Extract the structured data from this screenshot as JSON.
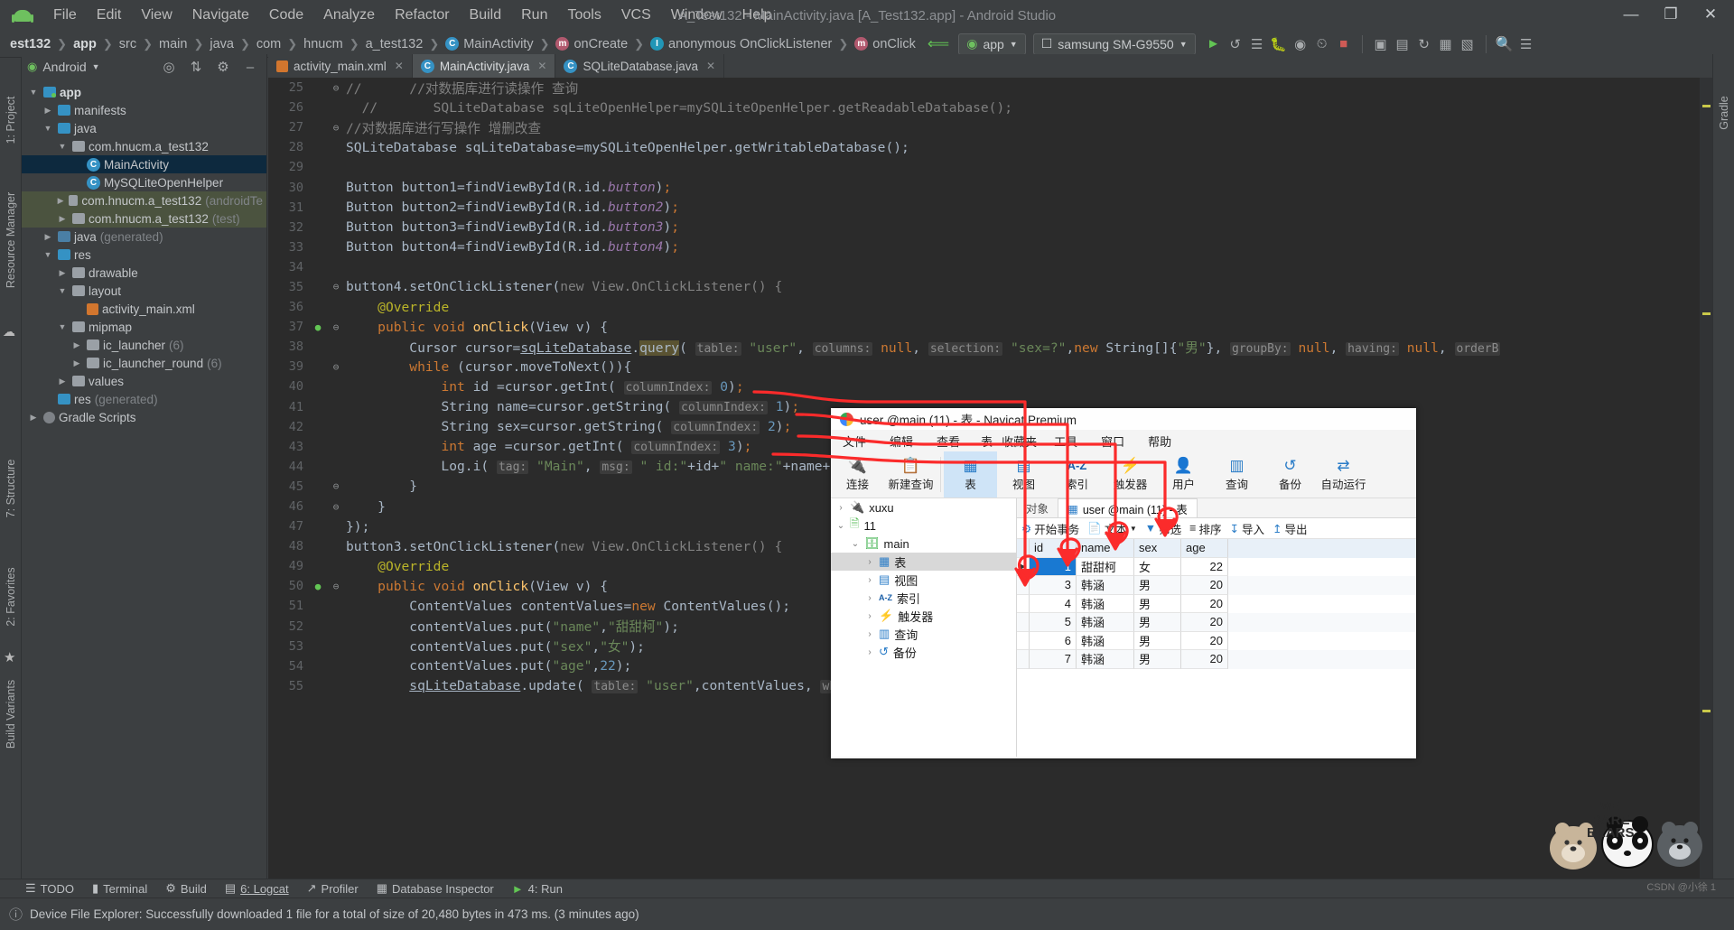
{
  "window": {
    "title": "A_Test132 - MainActivity.java [A_Test132.app] - Android Studio",
    "minimize": "—",
    "maximize": "❐",
    "close": "✕"
  },
  "menubar": {
    "items": [
      "File",
      "Edit",
      "View",
      "Navigate",
      "Code",
      "Analyze",
      "Refactor",
      "Build",
      "Run",
      "Tools",
      "VCS",
      "Window",
      "Help"
    ]
  },
  "breadcrumb": {
    "items": [
      {
        "label": "est132",
        "bold": true,
        "icon": ""
      },
      {
        "label": "app",
        "bold": true,
        "icon": ""
      },
      {
        "label": "src",
        "bold": false,
        "icon": ""
      },
      {
        "label": "main",
        "bold": false,
        "icon": ""
      },
      {
        "label": "java",
        "bold": false,
        "icon": ""
      },
      {
        "label": "com",
        "bold": false,
        "icon": ""
      },
      {
        "label": "hnucm",
        "bold": false,
        "icon": ""
      },
      {
        "label": "a_test132",
        "bold": false,
        "icon": ""
      },
      {
        "label": "MainActivity",
        "bold": false,
        "icon": "class-icon"
      },
      {
        "label": "onCreate",
        "bold": false,
        "icon": "method-icon"
      },
      {
        "label": "anonymous OnClickListener",
        "bold": false,
        "icon": "interface-icon"
      },
      {
        "label": "onClick",
        "bold": false,
        "icon": "method-icon"
      }
    ]
  },
  "toolbar": {
    "module_selector": "app",
    "device_selector": "samsung SM-G9550",
    "run_icon": "run-icon",
    "debug_icon": "debug-icon",
    "search_icon": "search-icon",
    "icons": [
      "run-icon",
      "apply-changes-icon",
      "restart-icon",
      "logcat-icon",
      "debug-icon",
      "attach-debugger-icon",
      "stop-icon",
      "avd-manager-icon",
      "sdk-manager-icon",
      "sync-icon",
      "profiler-icon",
      "search-icon",
      "menu-icon"
    ]
  },
  "left_strip": {
    "items": [
      "1: Project",
      "Resource Manager"
    ]
  },
  "left_strip_bottom": {
    "items": [
      "7: Structure",
      "2: Favorites",
      "Build Variants"
    ]
  },
  "project_panel": {
    "title": "Android",
    "chevron": "▾",
    "icons": [
      "target-icon",
      "collapse-all-icon",
      "settings-icon",
      "hide-icon"
    ],
    "tree": [
      {
        "indent": 0,
        "arrow": "▼",
        "icon": "folder-module",
        "label": "app",
        "suffix": "",
        "bold": true,
        "state": ""
      },
      {
        "indent": 1,
        "arrow": "▶",
        "icon": "folder",
        "label": "manifests",
        "suffix": "",
        "bold": false,
        "state": ""
      },
      {
        "indent": 1,
        "arrow": "▼",
        "icon": "folder",
        "label": "java",
        "suffix": "",
        "bold": false,
        "state": ""
      },
      {
        "indent": 2,
        "arrow": "▼",
        "icon": "package",
        "label": "com.hnucm.a_test132",
        "suffix": "",
        "bold": false,
        "state": ""
      },
      {
        "indent": 3,
        "arrow": "",
        "icon": "class-icon",
        "label": "MainActivity",
        "suffix": "",
        "bold": false,
        "state": "sel"
      },
      {
        "indent": 3,
        "arrow": "",
        "icon": "class-icon",
        "label": "MySQLiteOpenHelper",
        "suffix": "",
        "bold": false,
        "state": ""
      },
      {
        "indent": 2,
        "arrow": "▶",
        "icon": "package",
        "label": "com.hnucm.a_test132",
        "suffix": "(androidTe",
        "bold": false,
        "state": "green"
      },
      {
        "indent": 2,
        "arrow": "▶",
        "icon": "package",
        "label": "com.hnucm.a_test132",
        "suffix": "(test)",
        "bold": false,
        "state": "green"
      },
      {
        "indent": 1,
        "arrow": "▶",
        "icon": "folder-gen",
        "label": "java",
        "suffix": "(generated)",
        "bold": false,
        "state": ""
      },
      {
        "indent": 1,
        "arrow": "▼",
        "icon": "folder-res",
        "label": "res",
        "suffix": "",
        "bold": false,
        "state": ""
      },
      {
        "indent": 2,
        "arrow": "▶",
        "icon": "package",
        "label": "drawable",
        "suffix": "",
        "bold": false,
        "state": ""
      },
      {
        "indent": 2,
        "arrow": "▼",
        "icon": "package",
        "label": "layout",
        "suffix": "",
        "bold": false,
        "state": ""
      },
      {
        "indent": 3,
        "arrow": "",
        "icon": "xml-icon",
        "label": "activity_main.xml",
        "suffix": "",
        "bold": false,
        "state": ""
      },
      {
        "indent": 2,
        "arrow": "▼",
        "icon": "package",
        "label": "mipmap",
        "suffix": "",
        "bold": false,
        "state": ""
      },
      {
        "indent": 3,
        "arrow": "▶",
        "icon": "package",
        "label": "ic_launcher",
        "suffix": "(6)",
        "bold": false,
        "state": ""
      },
      {
        "indent": 3,
        "arrow": "▶",
        "icon": "package",
        "label": "ic_launcher_round",
        "suffix": "(6)",
        "bold": false,
        "state": ""
      },
      {
        "indent": 2,
        "arrow": "▶",
        "icon": "package",
        "label": "values",
        "suffix": "",
        "bold": false,
        "state": ""
      },
      {
        "indent": 1,
        "arrow": "",
        "icon": "folder-res",
        "label": "res",
        "suffix": "(generated)",
        "bold": false,
        "state": ""
      },
      {
        "indent": 0,
        "arrow": "▶",
        "icon": "gradle-icon",
        "label": "Gradle Scripts",
        "suffix": "",
        "bold": false,
        "state": ""
      }
    ]
  },
  "editor": {
    "tabs": [
      {
        "label": "activity_main.xml",
        "icon": "xml-icon",
        "active": false
      },
      {
        "label": "MainActivity.java",
        "icon": "class-icon",
        "active": true
      },
      {
        "label": "SQLiteDatabase.java",
        "icon": "class-icon",
        "active": false
      }
    ],
    "first_line": 25,
    "lines": [
      {
        "n": 25,
        "fold": "⊖",
        "gut": "",
        "html": "<span class=\"cmt\">//      //对数据库进行读操作 查询</span>"
      },
      {
        "n": 26,
        "fold": "",
        "gut": "",
        "html": "<span class=\"cmt\">  //       SQLiteDatabase sqLiteOpenHelper=mySQLiteOpenHelper.getReadableDatabase();</span>"
      },
      {
        "n": 27,
        "fold": "⊖",
        "gut": "",
        "html": "<span class=\"cmt\">//对数据库进行写操作 增删改查</span>"
      },
      {
        "n": 28,
        "fold": "",
        "gut": "",
        "html": "<span class=\"typ\">SQLiteDatabase</span> sqLiteDatabase=mySQLiteOpenHelper.getWritableDatabase();"
      },
      {
        "n": 29,
        "fold": "",
        "gut": "",
        "html": ""
      },
      {
        "n": 30,
        "fold": "",
        "gut": "",
        "html": "<span class=\"typ\">Button</span> button1=findViewById(R.id.<span class=\"fld\"><i>button</i></span>)<span class=\"kw\">;</span>"
      },
      {
        "n": 31,
        "fold": "",
        "gut": "",
        "html": "<span class=\"typ\">Button</span> button2=findViewById(R.id.<span class=\"fld\"><i>button2</i></span>)<span class=\"kw\">;</span>"
      },
      {
        "n": 32,
        "fold": "",
        "gut": "",
        "html": "<span class=\"typ\">Button</span> button3=findViewById(R.id.<span class=\"fld\"><i>button3</i></span>)<span class=\"kw\">;</span>"
      },
      {
        "n": 33,
        "fold": "",
        "gut": "",
        "html": "<span class=\"typ\">Button</span> button4=findViewById(R.id.<span class=\"fld\"><i>button4</i></span>)<span class=\"kw\">;</span>"
      },
      {
        "n": 34,
        "fold": "",
        "gut": "",
        "html": ""
      },
      {
        "n": 35,
        "fold": "⊖",
        "gut": "",
        "html": "button4.setOnClickListener(<span class=\"grey\">new View.OnClickListener() {</span>"
      },
      {
        "n": 36,
        "fold": "",
        "gut": "",
        "html": "    <span class=\"ann\">@Override</span>"
      },
      {
        "n": 37,
        "fold": "⊖",
        "gut": "bp",
        "html": "    <span class=\"kw\">public void</span> <span class=\"meth\">onClick</span>(<span class=\"typ\">View</span> v) {"
      },
      {
        "n": 38,
        "fold": "",
        "gut": "",
        "html": "        <span class=\"typ\">Cursor</span> cursor=<span class=\"undl\">sqLiteDatabase</span>.<span class=\"hl\">query</span>( <span class=\"hint\">table:</span> <span class=\"str\">\"user\"</span>, <span class=\"hint\">columns:</span> <span class=\"kw\">null</span>, <span class=\"hint\">selection:</span> <span class=\"str\">\"sex=?\"</span>,<span class=\"kw\">new</span> <span class=\"typ\">String</span>[]{<span class=\"str\">\"男\"</span>}, <span class=\"hint\">groupBy:</span> <span class=\"kw\">null</span>, <span class=\"hint\">having:</span> <span class=\"kw\">null</span>, <span class=\"hint\">orderB</span>"
      },
      {
        "n": 39,
        "fold": "⊖",
        "gut": "",
        "html": "        <span class=\"kw\">while</span> (cursor.moveToNext()){"
      },
      {
        "n": 40,
        "fold": "",
        "gut": "",
        "html": "            <span class=\"kw\">int</span> id =cursor.getInt( <span class=\"hint\">columnIndex:</span> <span class=\"num\">0</span>)<span class=\"kw\">;</span>"
      },
      {
        "n": 41,
        "fold": "",
        "gut": "",
        "html": "            <span class=\"typ\">String</span> name=cursor.getString( <span class=\"hint\">columnIndex:</span> <span class=\"num\">1</span>)<span class=\"kw\">;</span>"
      },
      {
        "n": 42,
        "fold": "",
        "gut": "",
        "html": "            <span class=\"typ\">String</span> sex=cursor.getString( <span class=\"hint\">columnIndex:</span> <span class=\"num\">2</span>)<span class=\"kw\">;</span>"
      },
      {
        "n": 43,
        "fold": "",
        "gut": "",
        "html": "            <span class=\"kw\">int</span> age =cursor.getInt( <span class=\"hint\">columnIndex:</span> <span class=\"num\">3</span>)<span class=\"kw\">;</span>"
      },
      {
        "n": 44,
        "fold": "",
        "gut": "",
        "html": "            Log.i( <span class=\"hint\">tag:</span> <span class=\"str\">\"Main\"</span>, <span class=\"hint\">msg:</span> <span class=\"str\">\" id:\"</span>+id+<span class=\"str\">\" name:\"</span>+name+<span class=\"str\">\"</span>"
      },
      {
        "n": 45,
        "fold": "⊖",
        "gut": "",
        "html": "        }"
      },
      {
        "n": 46,
        "fold": "⊖",
        "gut": "",
        "html": "    }"
      },
      {
        "n": 47,
        "fold": "",
        "gut": "",
        "html": "});"
      },
      {
        "n": 48,
        "fold": "",
        "gut": "",
        "html": "button3.setOnClickListener(<span class=\"grey\">new View.OnClickListener() {</span>"
      },
      {
        "n": 49,
        "fold": "",
        "gut": "",
        "html": "    <span class=\"ann\">@Override</span>"
      },
      {
        "n": 50,
        "fold": "⊖",
        "gut": "bp",
        "html": "    <span class=\"kw\">public void</span> <span class=\"meth\">onClick</span>(<span class=\"typ\">View</span> v) {"
      },
      {
        "n": 51,
        "fold": "",
        "gut": "",
        "html": "        <span class=\"typ\">ContentValues</span> contentValues=<span class=\"kw\">new</span> ContentValues();"
      },
      {
        "n": 52,
        "fold": "",
        "gut": "",
        "html": "        contentValues.put(<span class=\"str\">\"name\"</span>,<span class=\"str\">\"甜甜柯\"</span>);"
      },
      {
        "n": 53,
        "fold": "",
        "gut": "",
        "html": "        contentValues.put(<span class=\"str\">\"sex\"</span>,<span class=\"str\">\"女\"</span>);"
      },
      {
        "n": 54,
        "fold": "",
        "gut": "",
        "html": "        contentValues.put(<span class=\"str\">\"age\"</span>,<span class=\"num\">22</span>);"
      },
      {
        "n": 55,
        "fold": "",
        "gut": "",
        "html": "        <span class=\"undl\">sqLiteDatabase</span>.update( <span class=\"hint\">table:</span> <span class=\"str\">\"user\"</span>,contentValues, <span class=\"hint\">wh</span>"
      }
    ]
  },
  "bottom_bar": {
    "items": [
      {
        "icon": "todo-icon",
        "label": "TODO"
      },
      {
        "icon": "terminal-icon",
        "label": "Terminal"
      },
      {
        "icon": "build-icon",
        "label": "Build"
      },
      {
        "icon": "logcat-icon",
        "label": "6: Logcat"
      },
      {
        "icon": "profiler-icon",
        "label": "Profiler"
      },
      {
        "icon": "database-icon",
        "label": "Database Inspector"
      },
      {
        "icon": "run-icon",
        "label": "4: Run"
      }
    ]
  },
  "status_bar": {
    "icon": "info-icon",
    "message": "Device File Explorer: Successfully downloaded 1 file for a total of size of 20,480 bytes in 473 ms. (3 minutes ago)"
  },
  "navicat": {
    "title": "user @main (11) - 表 - Navicat Premium",
    "menu": [
      "文件",
      "编辑",
      "查看",
      "表",
      "收藏夹",
      "工具",
      "窗口",
      "帮助"
    ],
    "ribbon": [
      {
        "icon": "connection-icon",
        "label": "连接",
        "active": false
      },
      {
        "icon": "new-query-icon",
        "label": "新建查询",
        "active": false
      },
      {
        "icon": "table-icon",
        "label": "表",
        "active": true
      },
      {
        "icon": "view-icon",
        "label": "视图",
        "active": false
      },
      {
        "icon": "index-icon",
        "label": "索引",
        "active": false
      },
      {
        "icon": "trigger-icon",
        "label": "触发器",
        "active": false
      },
      {
        "icon": "user-icon",
        "label": "用户",
        "active": false
      },
      {
        "icon": "query-icon",
        "label": "查询",
        "active": false
      },
      {
        "icon": "backup-icon",
        "label": "备份",
        "active": false
      },
      {
        "icon": "automation-icon",
        "label": "自动运行",
        "active": false
      }
    ],
    "tree": [
      {
        "indent": 0,
        "chev": "›",
        "icon": "connection-icon",
        "label": "xuxu",
        "sel": false
      },
      {
        "indent": 0,
        "chev": "⌄",
        "icon": "sqlite-icon",
        "label": "11",
        "sel": false
      },
      {
        "indent": 1,
        "chev": "⌄",
        "icon": "database-icon",
        "label": "main",
        "sel": false
      },
      {
        "indent": 2,
        "chev": "›",
        "icon": "table-icon",
        "label": "表",
        "sel": true
      },
      {
        "indent": 2,
        "chev": "›",
        "icon": "view-icon",
        "label": "视图",
        "sel": false
      },
      {
        "indent": 2,
        "chev": "›",
        "icon": "index-icon",
        "label": "索引",
        "sel": false
      },
      {
        "indent": 2,
        "chev": "›",
        "icon": "trigger-icon",
        "label": "触发器",
        "sel": false
      },
      {
        "indent": 2,
        "chev": "›",
        "icon": "query-icon",
        "label": "查询",
        "sel": false
      },
      {
        "indent": 2,
        "chev": "›",
        "icon": "backup-icon",
        "label": "备份",
        "sel": false
      }
    ],
    "tabs": [
      {
        "label": "对象",
        "icon": "",
        "active": false
      },
      {
        "label": "user @main (11) - 表",
        "icon": "table-icon",
        "active": true
      }
    ],
    "ops": [
      {
        "icon": "transaction-icon",
        "label": "开始事务"
      },
      {
        "icon": "text-icon",
        "label": "文本"
      },
      {
        "icon": "filter-icon",
        "label": "筛选"
      },
      {
        "icon": "sort-icon",
        "label": "排序"
      },
      {
        "icon": "import-icon",
        "label": "导入"
      },
      {
        "icon": "export-icon",
        "label": "导出"
      }
    ],
    "grid": {
      "columns": [
        "id",
        "name",
        "sex",
        "age"
      ],
      "rows": [
        {
          "id": "1",
          "name": "甜甜柯",
          "sex": "女",
          "age": "22",
          "current": true
        },
        {
          "id": "3",
          "name": "韩涵",
          "sex": "男",
          "age": "20",
          "current": false
        },
        {
          "id": "4",
          "name": "韩涵",
          "sex": "男",
          "age": "20",
          "current": false
        },
        {
          "id": "5",
          "name": "韩涵",
          "sex": "男",
          "age": "20",
          "current": false
        },
        {
          "id": "6",
          "name": "韩涵",
          "sex": "男",
          "age": "20",
          "current": false
        },
        {
          "id": "7",
          "name": "韩涵",
          "sex": "男",
          "age": "20",
          "current": false
        }
      ]
    }
  },
  "watermark": {
    "line1": "WE",
    "line2": "BARE",
    "line3": "BEARS",
    "credit": "CSDN @小徐 1"
  },
  "colors": {
    "accent": "#3592c4",
    "annotation": "#fb2b2b",
    "selection": "#0d293e",
    "ide_bg": "#3c3f41",
    "editor_bg": "#2b2b2b",
    "navicat_accent": "#1979d2"
  }
}
